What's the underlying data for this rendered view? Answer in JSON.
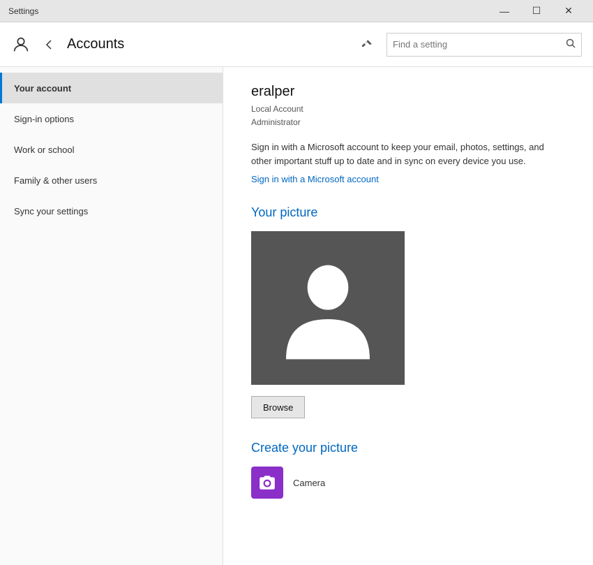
{
  "titlebar": {
    "title": "Settings",
    "minimize": "—",
    "maximize": "☐",
    "close": "✕"
  },
  "header": {
    "title": "Accounts",
    "search_placeholder": "Find a setting",
    "pin_icon": "📌"
  },
  "sidebar": {
    "items": [
      {
        "id": "your-account",
        "label": "Your account",
        "active": true
      },
      {
        "id": "sign-in-options",
        "label": "Sign-in options",
        "active": false
      },
      {
        "id": "work-or-school",
        "label": "Work or school",
        "active": false
      },
      {
        "id": "family-other-users",
        "label": "Family & other users",
        "active": false
      },
      {
        "id": "sync-settings",
        "label": "Sync your settings",
        "active": false
      }
    ]
  },
  "content": {
    "username": "eralper",
    "account_line1": "Local Account",
    "account_line2": "Administrator",
    "signin_description": "Sign in with a Microsoft account to keep your email, photos, settings, and other important stuff up to date and in sync on every device you use.",
    "signin_link": "Sign in with a Microsoft account",
    "your_picture_title": "Your picture",
    "browse_label": "Browse",
    "create_picture_title": "Create your picture",
    "camera_label": "Camera"
  }
}
